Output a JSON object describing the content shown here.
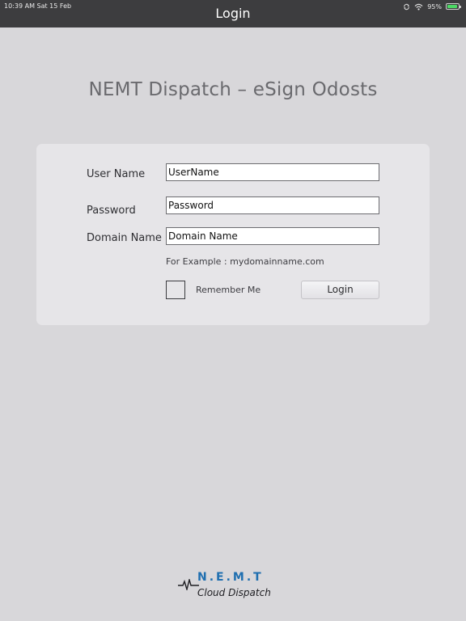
{
  "status_bar": {
    "time_date": "10:39 AM   Sat 15 Feb",
    "battery_percent": "95%",
    "battery_level": 0.95
  },
  "nav": {
    "title": "Login"
  },
  "heading": "NEMT Dispatch – eSign Odosts",
  "form": {
    "username_label": "User Name",
    "username_value": "UserName",
    "password_label": "Password",
    "password_value": "Password",
    "domain_label": "Domain Name",
    "domain_value": "Domain Name",
    "hint": "For Example : mydomainname.com",
    "remember_label": "Remember Me",
    "remember_checked": false,
    "login_button": "Login"
  },
  "logo": {
    "top_text": "N.E.M.T",
    "bottom_text": "Cloud Dispatch"
  },
  "colors": {
    "background": "#d8d7da",
    "navbar": "#3d3d3f",
    "card": "#e6e5e8",
    "logo_blue": "#1f6fb0",
    "battery_green": "#4cd964"
  }
}
